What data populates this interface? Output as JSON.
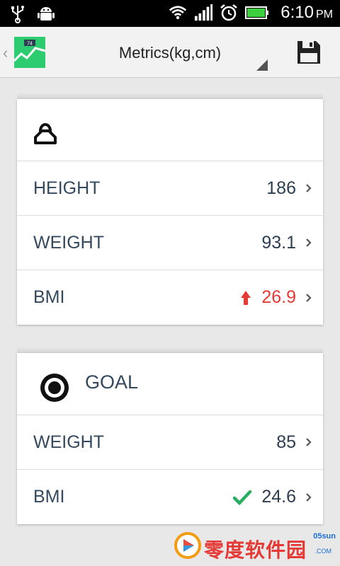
{
  "status_bar": {
    "time": "6:10",
    "ampm": "PM",
    "icons": [
      "usb-icon",
      "android-debug-icon",
      "wifi-icon",
      "signal-icon",
      "alarm-icon",
      "battery-icon"
    ]
  },
  "action_bar": {
    "app_icon": "chart-app-icon",
    "app_icon_badge": "74",
    "spinner_title": "Metrics(kg,cm)",
    "save_icon": "save-icon"
  },
  "profile_card": {
    "header_icon": "person-icon",
    "rows": [
      {
        "label": "HEIGHT",
        "value": "186"
      },
      {
        "label": "WEIGHT",
        "value": "93.1"
      },
      {
        "label": "BMI",
        "value": "26.9",
        "indicator": "arrow-up-icon",
        "value_color": "#e53935"
      }
    ]
  },
  "goal_card": {
    "header_icon": "target-icon",
    "title": "GOAL",
    "rows": [
      {
        "label": "WEIGHT",
        "value": "85"
      },
      {
        "label": "BMI",
        "value": "24.6",
        "indicator": "checkmark-icon",
        "indicator_color": "#27ae60"
      }
    ]
  },
  "watermark": {
    "text": "零度软件园",
    "small": "05sun",
    "com": ".COM"
  },
  "colors": {
    "text_primary": "#34495e",
    "alert": "#e53935",
    "ok": "#27ae60",
    "app_icon_green": "#2ecc71"
  }
}
